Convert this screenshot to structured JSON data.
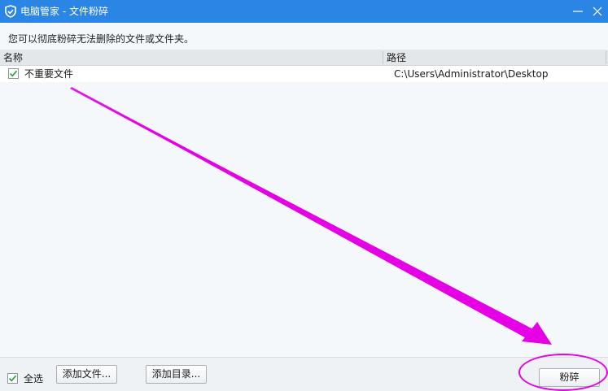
{
  "window": {
    "title": "电脑管家 - 文件粉碎",
    "minimize_icon": "minimize-icon",
    "close_icon": "close-icon"
  },
  "description": "您可以彻底粉碎无法删除的文件或文件夹。",
  "columns": {
    "name": "名称",
    "path": "路径"
  },
  "files": [
    {
      "name": "不重要文件",
      "path": "C:\\Users\\Administrator\\Desktop",
      "checked": true
    }
  ],
  "footer": {
    "select_all": "全选",
    "add_file": "添加文件...",
    "add_dir": "添加目录...",
    "shred": "粉碎"
  },
  "colors": {
    "title_bar": "#2b85e4",
    "annotation": "#e600e6"
  }
}
